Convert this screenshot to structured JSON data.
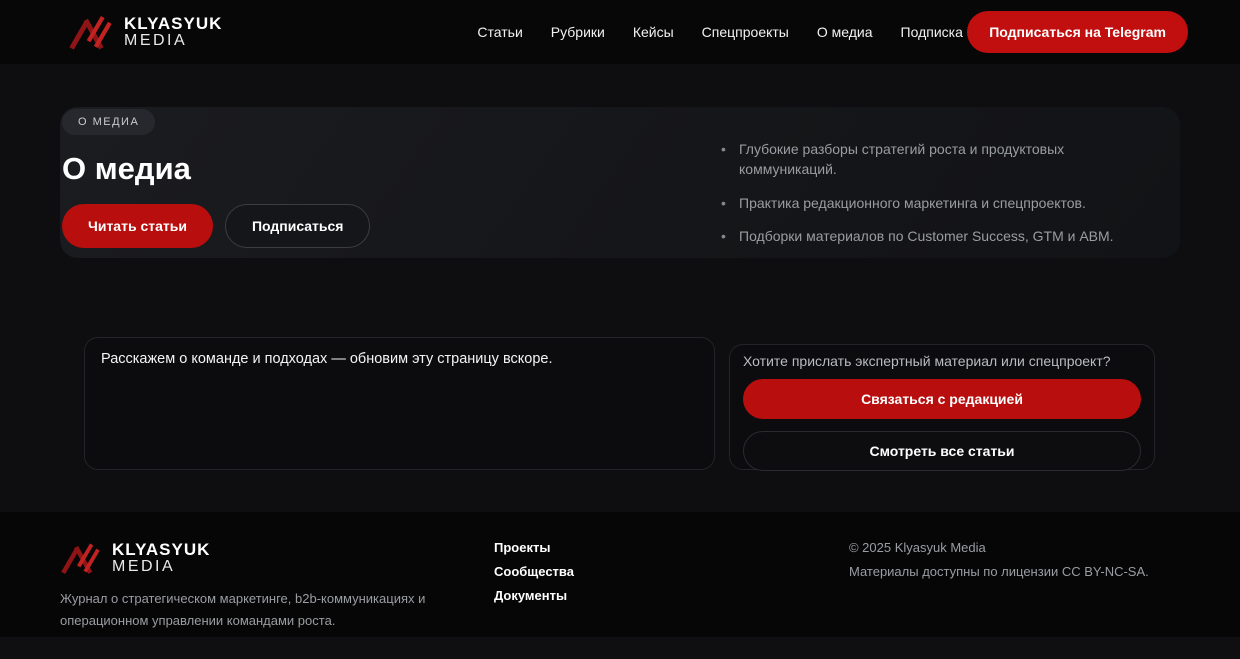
{
  "brand": {
    "name_top": "KLYASYUK",
    "name_bottom": "MEDIA"
  },
  "header": {
    "nav": [
      "Статьи",
      "Рубрики",
      "Кейсы",
      "Спецпроекты",
      "О медиа",
      "Подписка"
    ],
    "telegram_cta": "Подписаться на Telegram"
  },
  "hero": {
    "badge": "О МЕДИА",
    "title": "О медиа",
    "primary_cta": "Читать статьи",
    "secondary_cta": "Подписаться",
    "bullets": [
      "Глубокие разборы стратегий роста и продуктовых коммуникаций.",
      "Практика редакционного маркетинга и спецпроектов.",
      "Подборки материалов по Customer Success, GTM и ABM."
    ]
  },
  "main": {
    "about_text": "Расскажем о команде и подходах — обновим эту страницу вскоре.",
    "cta_question": "Хотите прислать экспертный материал или спецпроект?",
    "contact_button": "Связаться с редакцией",
    "all_articles_button": "Смотреть все статьи"
  },
  "footer": {
    "tagline": "Журнал о стратегическом маркетинге, b2b-коммуникациях и операционном управлении командами роста.",
    "links": [
      "Проекты",
      "Сообщества",
      "Документы"
    ],
    "copyright": "© 2025 Klyasyuk Media",
    "license": "Материалы доступны по лицензии CC BY-NC-SA."
  },
  "colors": {
    "accent_red": "#b90e0e",
    "logo_red_dark": "#8f1416",
    "logo_red_bright": "#c32222",
    "page_bg": "#0e0e10",
    "header_bg": "#070708",
    "footer_bg": "#060607"
  }
}
